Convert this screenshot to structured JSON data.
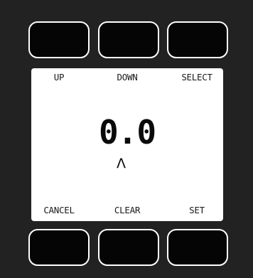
{
  "softkeys": {
    "top": [
      "UP",
      "DOWN",
      "SELECT"
    ],
    "bottom": [
      "CANCEL",
      "CLEAR",
      "SET"
    ]
  },
  "display": {
    "value": "0.0",
    "cursor_glyph": "Λ"
  }
}
